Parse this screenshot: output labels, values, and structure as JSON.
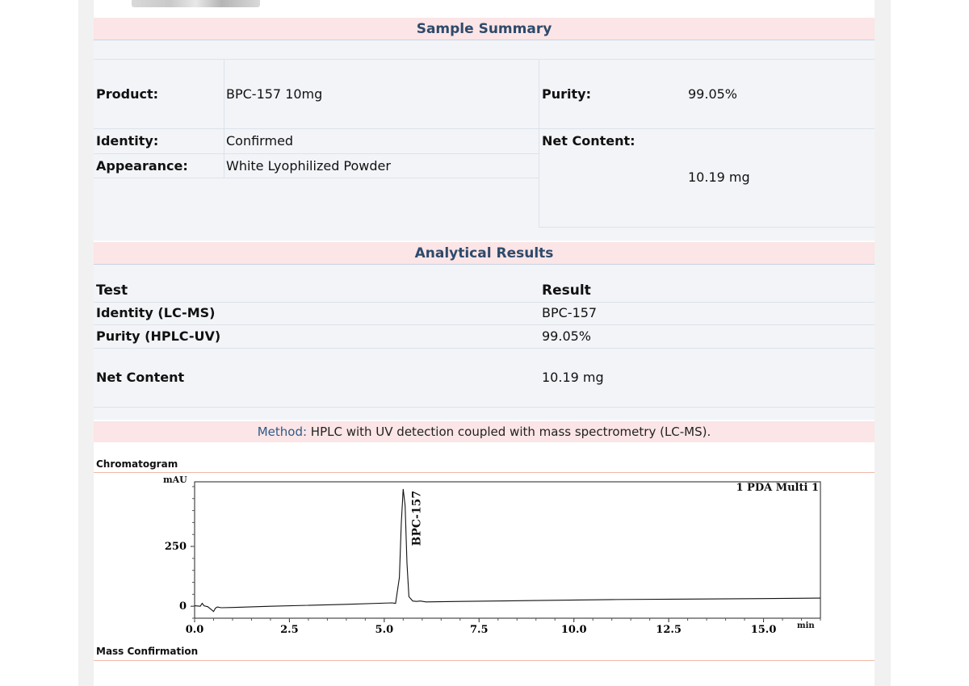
{
  "sample_summary": {
    "title": "Sample Summary",
    "product_label": "Product:",
    "product_value": "BPC-157 10mg",
    "purity_label": "Purity:",
    "purity_value": "99.05%",
    "identity_label": "Identity:",
    "identity_value": "Confirmed",
    "net_content_label": "Net Content:",
    "net_content_value": "10.19 mg",
    "appearance_label": "Appearance:",
    "appearance_value": "White Lyophilized Powder"
  },
  "analytical_results": {
    "title": "Analytical Results",
    "headers": [
      "Test",
      "Result"
    ],
    "rows": [
      {
        "test": "Identity (LC-MS)",
        "result": "BPC-157"
      },
      {
        "test": "Purity (HPLC-UV)",
        "result": "99.05%"
      },
      {
        "test": "Net Content",
        "result": "10.19 mg"
      }
    ]
  },
  "method": {
    "key": "Method:",
    "text": " HPLC with UV detection coupled with mass spectrometry (LC-MS)."
  },
  "chromatogram_label": "Chromatogram",
  "mass_confirmation_label": "Mass Confirmation",
  "chart_data": {
    "type": "line",
    "ylabel": "mAU",
    "xlabel": "min",
    "legend": "1 PDA Multi 1",
    "x_ticks": [
      "0.0",
      "2.5",
      "5.0",
      "7.5",
      "10.0",
      "12.5",
      "15.0"
    ],
    "y_ticks": [
      "0",
      "250"
    ],
    "xlim": [
      0,
      16.5
    ],
    "ylim": [
      -50,
      520
    ],
    "peak": {
      "label": "BPC-157",
      "retention_time": 5.5,
      "height": 490
    },
    "series": [
      {
        "x": [
          0,
          0.15,
          0.2,
          0.25,
          0.35,
          0.5,
          0.55,
          0.6,
          0.7,
          1.0,
          2.0,
          4.0,
          5.2,
          5.3,
          5.4,
          5.45,
          5.5,
          5.55,
          5.6,
          5.65,
          5.75,
          5.85,
          5.95,
          6.1,
          7.0,
          9.0,
          11.0,
          13.0,
          15.0,
          16.5
        ],
        "y": [
          2,
          0,
          12,
          2,
          -2,
          -22,
          -8,
          -3,
          -6,
          -5,
          0,
          8,
          14,
          12,
          120,
          350,
          490,
          420,
          180,
          40,
          22,
          20,
          22,
          18,
          20,
          24,
          28,
          30,
          32,
          34
        ]
      }
    ],
    "grid": false
  }
}
